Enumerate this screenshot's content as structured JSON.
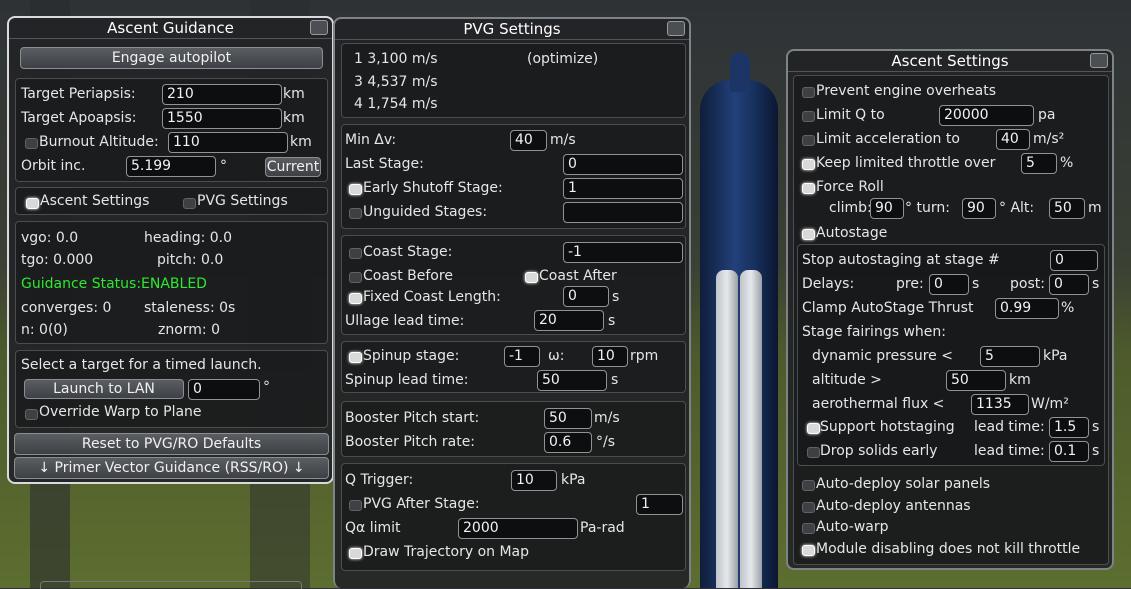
{
  "ascent_guidance": {
    "title": "Ascent Guidance",
    "engage_label": "Engage autopilot",
    "target_periapsis_label": "Target Periapsis:",
    "target_periapsis_value": "210",
    "target_periapsis_unit": "km",
    "target_apoapsis_label": "Target Apoapsis:",
    "target_apoapsis_value": "1550",
    "target_apoapsis_unit": "km",
    "burnout_label": "Burnout Altitude:",
    "burnout_value": "110",
    "burnout_unit": "km",
    "orbit_inc_label": "Orbit inc.",
    "orbit_inc_value": "5.199",
    "orbit_inc_unit": "°",
    "current_label": "Current",
    "tab_ascent_settings": "Ascent Settings",
    "tab_pvg_settings": "PVG Settings",
    "vgo": "vgo: 0.0",
    "heading": "heading: 0.0",
    "tgo": "tgo: 0.000",
    "pitch": "pitch: 0.0",
    "status": "Guidance Status:ENABLED",
    "converges": "converges: 0",
    "staleness": "staleness: 0s",
    "n": "n: 0(0)",
    "znorm": "znorm: 0",
    "timed_launch_text": "Select a target for a timed launch.",
    "launch_to_lan_label": "Launch to LAN",
    "launch_to_lan_value": "0",
    "launch_to_lan_unit": "°",
    "override_warp_label": "Override Warp to Plane",
    "reset_label": "Reset to PVG/RO Defaults",
    "mode_label": "↓ Primer Vector Guidance (RSS/RO) ↓"
  },
  "pvg_settings": {
    "title": "PVG Settings",
    "stage_lines": [
      "1 3,100 m/s",
      "3 4,537 m/s",
      "4 1,754 m/s"
    ],
    "optimize_label": "(optimize)",
    "min_dv_label": "Min Δv:",
    "min_dv_value": "40",
    "min_dv_unit": "m/s",
    "last_stage_label": "Last Stage:",
    "last_stage_value": "0",
    "early_shutoff_label": "Early Shutoff Stage:",
    "early_shutoff_value": "1",
    "unguided_label": "Unguided Stages:",
    "unguided_value": "",
    "coast_stage_label": "Coast Stage:",
    "coast_stage_value": "-1",
    "coast_before_label": "Coast Before",
    "coast_after_label": "Coast After",
    "fixed_coast_label": "Fixed Coast Length:",
    "fixed_coast_value": "0",
    "fixed_coast_unit": "s",
    "ullage_label": "Ullage lead time:",
    "ullage_value": "20",
    "ullage_unit": "s",
    "spinup_stage_label": "Spinup stage:",
    "spinup_stage_value": "-1",
    "omega_label": "ω:",
    "omega_value": "10",
    "omega_unit": "rpm",
    "spinup_lead_label": "Spinup lead time:",
    "spinup_lead_value": "50",
    "spinup_lead_unit": "s",
    "booster_pitch_start_label": "Booster Pitch start:",
    "booster_pitch_start_value": "50",
    "booster_pitch_start_unit": "m/s",
    "booster_pitch_rate_label": "Booster Pitch rate:",
    "booster_pitch_rate_value": "0.6",
    "booster_pitch_rate_unit": "°/s",
    "q_trigger_label": "Q Trigger:",
    "q_trigger_value": "10",
    "q_trigger_unit": "kPa",
    "pvg_after_stage_label": "PVG After Stage:",
    "pvg_after_stage_value": "1",
    "q_alpha_label": "Qα limit",
    "q_alpha_value": "2000",
    "q_alpha_unit": "Pa-rad",
    "draw_trajectory_label": "Draw Trajectory on Map"
  },
  "ascent_settings": {
    "title": "Ascent Settings",
    "prevent_overheats": "Prevent engine overheats",
    "limit_q_label": "Limit Q to",
    "limit_q_value": "20000",
    "limit_q_unit": "pa",
    "limit_accel_label": "Limit acceleration to",
    "limit_accel_value": "40",
    "limit_accel_unit": "m/s²",
    "keep_throttle_label": "Keep limited throttle over",
    "keep_throttle_value": "5",
    "keep_throttle_unit": "%",
    "force_roll_label": "Force Roll",
    "climb_label": "climb:",
    "climb_value": "90",
    "turn_label": "° turn:",
    "turn_value": "90",
    "alt_label": "° Alt:",
    "alt_value": "50",
    "alt_unit": "m",
    "autostage_label": "Autostage",
    "stop_autostaging_label": "Stop autostaging at stage #",
    "stop_autostaging_value": "0",
    "delays_label": "Delays:",
    "pre_label": "pre:",
    "pre_value": "0",
    "pre_unit": "s",
    "post_label": "post:",
    "post_value": "0",
    "post_unit": "s",
    "clamp_label": "Clamp AutoStage Thrust",
    "clamp_value": "0.99",
    "clamp_unit": "%",
    "fairings_label": "Stage fairings when:",
    "dyn_pressure_label": "dynamic pressure <",
    "dyn_pressure_value": "5",
    "dyn_pressure_unit": "kPa",
    "altitude_label": "altitude >",
    "altitude_value": "50",
    "altitude_unit": "km",
    "aero_flux_label": "aerothermal flux <",
    "aero_flux_value": "1135",
    "aero_flux_unit": "W/m²",
    "hotstaging_label": "Support hotstaging",
    "hotstaging_lead_label": "lead time:",
    "hotstaging_lead_value": "1.5",
    "hotstaging_lead_unit": "s",
    "drop_solids_label": "Drop solids early",
    "drop_solids_lead_label": "lead time:",
    "drop_solids_lead_value": "0.1",
    "drop_solids_lead_unit": "s",
    "solar_label": "Auto-deploy solar panels",
    "antennas_label": "Auto-deploy antennas",
    "autowarp_label": "Auto-warp",
    "module_disabling_label": "Module disabling does not kill throttle"
  }
}
